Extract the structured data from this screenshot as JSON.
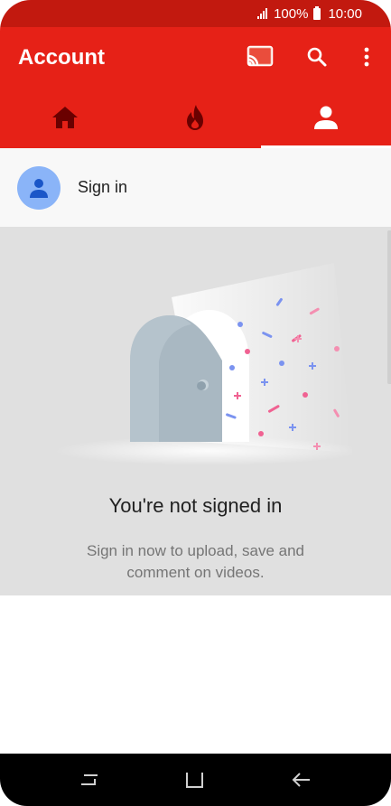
{
  "status_bar": {
    "battery": "100%",
    "time": "10:00"
  },
  "app_bar": {
    "title": "Account",
    "actions": [
      "cast-icon",
      "search-icon",
      "more-vert-icon"
    ]
  },
  "tabs": [
    {
      "icon": "home-icon",
      "active": false
    },
    {
      "icon": "trending-icon",
      "active": false
    },
    {
      "icon": "account-icon",
      "active": true
    }
  ],
  "signin": {
    "label": "Sign in"
  },
  "empty_state": {
    "heading": "You're not signed in",
    "message": "Sign in now to upload, save and comment on videos."
  },
  "colors": {
    "status_bar": "#c2190f",
    "app_bar": "#e62117",
    "avatar": "#8ab4f8",
    "empty_background": "#e0e0e0"
  },
  "nav_bar": [
    "recent-apps-icon",
    "home-button-icon",
    "back-icon"
  ]
}
